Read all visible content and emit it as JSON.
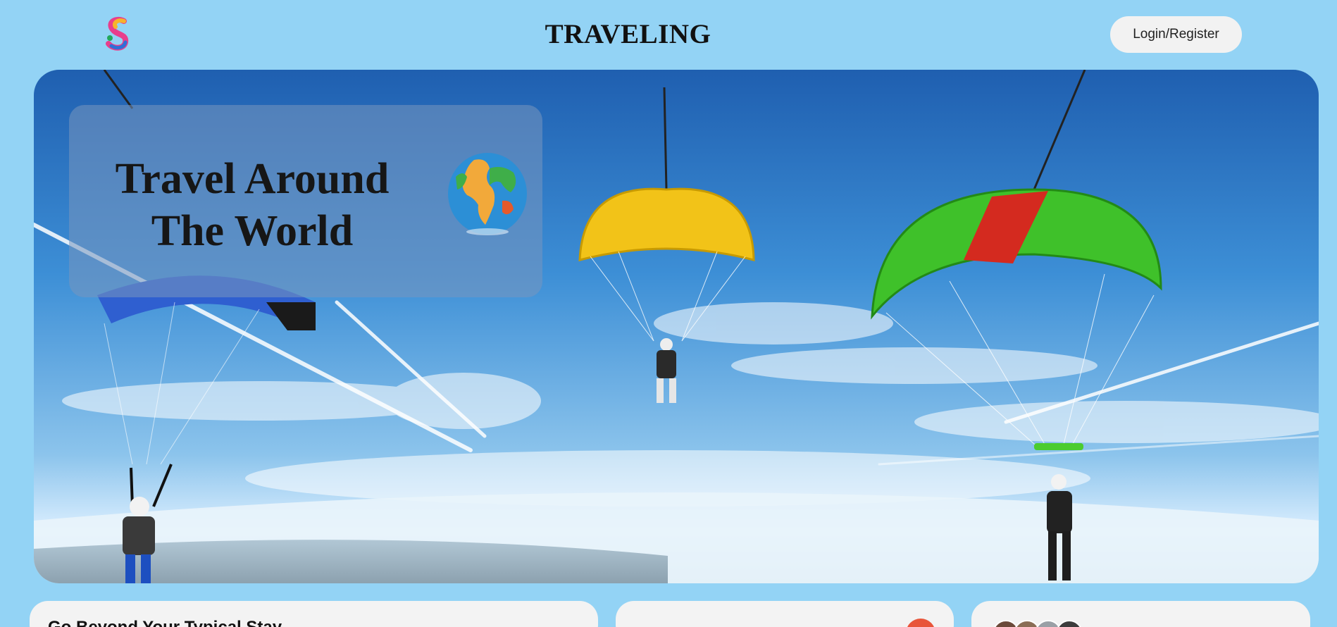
{
  "header": {
    "logo_icon": "colorful-s-logo-icon",
    "site_title": "TRAVELING",
    "login_label": "Login/Register"
  },
  "hero": {
    "headline_line1": "Travel Around",
    "headline_line2": "The World",
    "globe_icon": "globe-icon",
    "image_subject": "skydivers-with-parachutes"
  },
  "cards": {
    "card1_title": "Go Beyond Your Typical Stay"
  },
  "colors": {
    "page_background": "#93d3f5",
    "button_background": "#f2f2f2",
    "card_background": "#f3f3f3",
    "accent_orange": "#e8553a"
  }
}
